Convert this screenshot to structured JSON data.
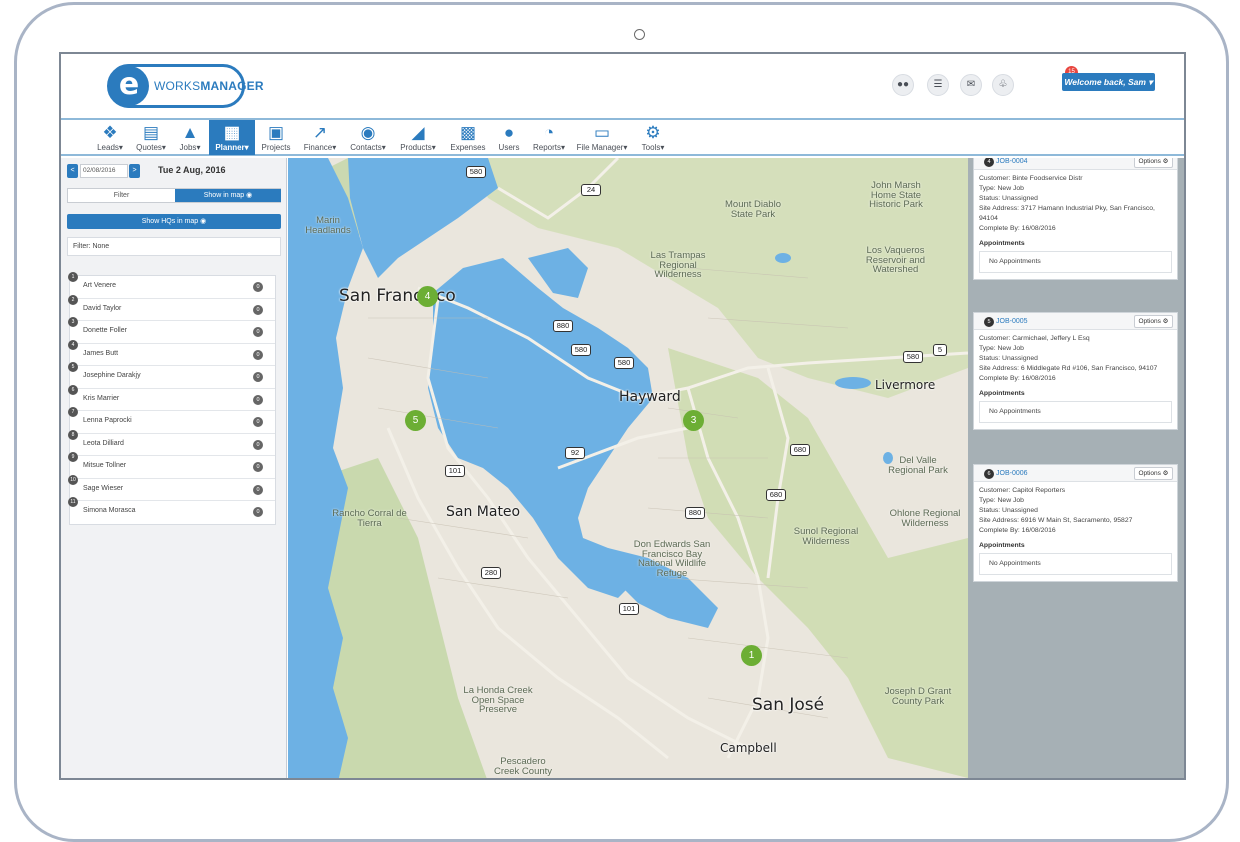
{
  "header": {
    "logo_letter": "e",
    "logo_text_1": "WORKS",
    "logo_text_2": "MANAGER",
    "notification_count": "15",
    "welcome": "Welcome back, Sam"
  },
  "nav": {
    "items": [
      {
        "label": "Leads",
        "icon": "pin-icon"
      },
      {
        "label": "Quotes",
        "icon": "document-icon"
      },
      {
        "label": "Jobs",
        "icon": "road-icon"
      },
      {
        "label": "Planner",
        "icon": "calendar-icon"
      },
      {
        "label": "Projects",
        "icon": "briefcase-icon"
      },
      {
        "label": "Finance",
        "icon": "chart-line-icon"
      },
      {
        "label": "Contacts",
        "icon": "chat-icon"
      },
      {
        "label": "Products",
        "icon": "cart-icon"
      },
      {
        "label": "Expenses",
        "icon": "calculator-icon"
      },
      {
        "label": "Users",
        "icon": "users-icon"
      },
      {
        "label": "Reports",
        "icon": "pie-chart-icon"
      },
      {
        "label": "File Manager",
        "icon": "pdf-file-icon"
      },
      {
        "label": "Tools",
        "icon": "gears-icon"
      }
    ]
  },
  "planner": {
    "date_input": "02/08/2016",
    "date_title": "Tue 2 Aug, 2016",
    "prev": "<",
    "next": ">",
    "filter_tab": "Filter",
    "show_in_map_tab": "Show in map",
    "show_hqs": "Show HQs in map",
    "filter_status": "Filter: None"
  },
  "staff": [
    {
      "num": "1",
      "name": "Art Venere",
      "count": "0"
    },
    {
      "num": "2",
      "name": "David Taylor",
      "count": "0"
    },
    {
      "num": "3",
      "name": "Donette Foller",
      "count": "0"
    },
    {
      "num": "4",
      "name": "James Butt",
      "count": "0"
    },
    {
      "num": "5",
      "name": "Josephine Darakjy",
      "count": "0"
    },
    {
      "num": "6",
      "name": "Kris Marrier",
      "count": "0"
    },
    {
      "num": "7",
      "name": "Lenna Paprocki",
      "count": "0"
    },
    {
      "num": "8",
      "name": "Leota Dilliard",
      "count": "0"
    },
    {
      "num": "9",
      "name": "Mitsue Tollner",
      "count": "0"
    },
    {
      "num": "10",
      "name": "Sage Wieser",
      "count": "0"
    },
    {
      "num": "11",
      "name": "Simona Morasca",
      "count": "0"
    }
  ],
  "map": {
    "cities": [
      "San Francisco",
      "Hayward",
      "San Mateo",
      "San José",
      "Livermore",
      "Campbell"
    ],
    "parks": [
      "Marin Headlands",
      "Mount Diablo State Park",
      "John Marsh Home State Historic Park",
      "Las Trampas Regional Wilderness",
      "Los Vaqueros Reservoir and Watershed",
      "Del Valle Regional Park",
      "Rancho Corral de Tierra",
      "Sunol Regional Wilderness",
      "Ohlone Regional Wilderness",
      "Don Edwards San Francisco Bay National Wildlife Refuge",
      "La Honda Creek Open Space Preserve",
      "Joseph D Grant County Park",
      "Pescadero Creek County"
    ],
    "markers": [
      "4",
      "5",
      "3",
      "1"
    ],
    "highways": [
      "580",
      "24",
      "880",
      "580",
      "580",
      "580",
      "5",
      "92",
      "680",
      "680",
      "101",
      "880",
      "280",
      "101"
    ]
  },
  "jobs": [
    {
      "num": "4",
      "id": "JOB-0004",
      "options": "Options",
      "customer": "Customer: Binte Foodservice Distr",
      "type": "Type: New Job",
      "status": "Status: Unassigned",
      "address": "Site Address: 3717 Hamann Industrial Pky, San Francisco, 94104",
      "complete_by": "Complete By: 16/08/2016",
      "appointments_label": "Appointments",
      "appointments": "No Appointments"
    },
    {
      "num": "5",
      "id": "JOB-0005",
      "options": "Options",
      "customer": "Customer: Carmichael, Jeffery L Esq",
      "type": "Type: New Job",
      "status": "Status: Unassigned",
      "address": "Site Address: 6 Middlegate Rd #106, San Francisco, 94107",
      "complete_by": "Complete By: 16/08/2016",
      "appointments_label": "Appointments",
      "appointments": "No Appointments"
    },
    {
      "num": "6",
      "id": "JOB-0006",
      "options": "Options",
      "customer": "Customer: Capitol Reporters",
      "type": "Type: New Job",
      "status": "Status: Unassigned",
      "address": "Site Address: 6916 W Main St, Sacramento, 95827",
      "complete_by": "Complete By: 16/08/2016",
      "appointments_label": "Appointments",
      "appointments": "No Appointments"
    }
  ],
  "colors": {
    "brand": "#2b7bbe",
    "marker": "#6cae34",
    "water": "#6db1e4",
    "land": "#eae6dd",
    "terrain": "#c3d6a6",
    "badge": "#e8463f"
  }
}
